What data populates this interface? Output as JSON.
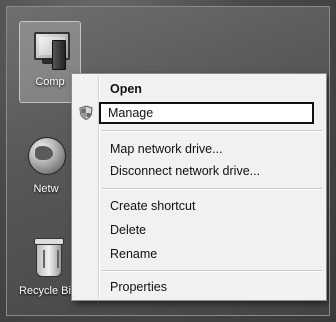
{
  "desktop": {
    "icons": [
      {
        "label": "Comp",
        "icon": "computer-icon"
      },
      {
        "label": "Netw",
        "icon": "network-icon"
      },
      {
        "label": "Recycle Bin",
        "icon": "recycle-bin-icon"
      }
    ]
  },
  "context_menu": {
    "items": [
      {
        "label": "Open",
        "bold": true
      },
      {
        "label": "Manage",
        "icon": "shield-icon",
        "highlighted": true
      },
      {
        "label": "Map network drive..."
      },
      {
        "label": "Disconnect network drive..."
      },
      {
        "label": "Create shortcut"
      },
      {
        "label": "Delete"
      },
      {
        "label": "Rename"
      },
      {
        "label": "Properties"
      }
    ]
  }
}
